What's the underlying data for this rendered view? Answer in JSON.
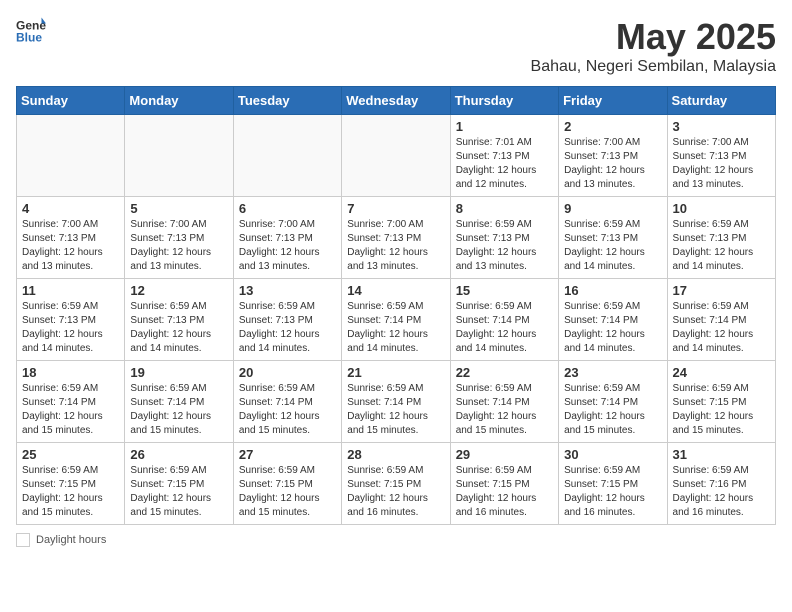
{
  "header": {
    "logo_general": "General",
    "logo_blue": "Blue",
    "title": "May 2025",
    "subtitle": "Bahau, Negeri Sembilan, Malaysia"
  },
  "days_of_week": [
    "Sunday",
    "Monday",
    "Tuesday",
    "Wednesday",
    "Thursday",
    "Friday",
    "Saturday"
  ],
  "weeks": [
    [
      {
        "day": "",
        "info": ""
      },
      {
        "day": "",
        "info": ""
      },
      {
        "day": "",
        "info": ""
      },
      {
        "day": "",
        "info": ""
      },
      {
        "day": "1",
        "info": "Sunrise: 7:01 AM\nSunset: 7:13 PM\nDaylight: 12 hours\nand 12 minutes."
      },
      {
        "day": "2",
        "info": "Sunrise: 7:00 AM\nSunset: 7:13 PM\nDaylight: 12 hours\nand 13 minutes."
      },
      {
        "day": "3",
        "info": "Sunrise: 7:00 AM\nSunset: 7:13 PM\nDaylight: 12 hours\nand 13 minutes."
      }
    ],
    [
      {
        "day": "4",
        "info": "Sunrise: 7:00 AM\nSunset: 7:13 PM\nDaylight: 12 hours\nand 13 minutes."
      },
      {
        "day": "5",
        "info": "Sunrise: 7:00 AM\nSunset: 7:13 PM\nDaylight: 12 hours\nand 13 minutes."
      },
      {
        "day": "6",
        "info": "Sunrise: 7:00 AM\nSunset: 7:13 PM\nDaylight: 12 hours\nand 13 minutes."
      },
      {
        "day": "7",
        "info": "Sunrise: 7:00 AM\nSunset: 7:13 PM\nDaylight: 12 hours\nand 13 minutes."
      },
      {
        "day": "8",
        "info": "Sunrise: 6:59 AM\nSunset: 7:13 PM\nDaylight: 12 hours\nand 13 minutes."
      },
      {
        "day": "9",
        "info": "Sunrise: 6:59 AM\nSunset: 7:13 PM\nDaylight: 12 hours\nand 14 minutes."
      },
      {
        "day": "10",
        "info": "Sunrise: 6:59 AM\nSunset: 7:13 PM\nDaylight: 12 hours\nand 14 minutes."
      }
    ],
    [
      {
        "day": "11",
        "info": "Sunrise: 6:59 AM\nSunset: 7:13 PM\nDaylight: 12 hours\nand 14 minutes."
      },
      {
        "day": "12",
        "info": "Sunrise: 6:59 AM\nSunset: 7:13 PM\nDaylight: 12 hours\nand 14 minutes."
      },
      {
        "day": "13",
        "info": "Sunrise: 6:59 AM\nSunset: 7:13 PM\nDaylight: 12 hours\nand 14 minutes."
      },
      {
        "day": "14",
        "info": "Sunrise: 6:59 AM\nSunset: 7:14 PM\nDaylight: 12 hours\nand 14 minutes."
      },
      {
        "day": "15",
        "info": "Sunrise: 6:59 AM\nSunset: 7:14 PM\nDaylight: 12 hours\nand 14 minutes."
      },
      {
        "day": "16",
        "info": "Sunrise: 6:59 AM\nSunset: 7:14 PM\nDaylight: 12 hours\nand 14 minutes."
      },
      {
        "day": "17",
        "info": "Sunrise: 6:59 AM\nSunset: 7:14 PM\nDaylight: 12 hours\nand 14 minutes."
      }
    ],
    [
      {
        "day": "18",
        "info": "Sunrise: 6:59 AM\nSunset: 7:14 PM\nDaylight: 12 hours\nand 15 minutes."
      },
      {
        "day": "19",
        "info": "Sunrise: 6:59 AM\nSunset: 7:14 PM\nDaylight: 12 hours\nand 15 minutes."
      },
      {
        "day": "20",
        "info": "Sunrise: 6:59 AM\nSunset: 7:14 PM\nDaylight: 12 hours\nand 15 minutes."
      },
      {
        "day": "21",
        "info": "Sunrise: 6:59 AM\nSunset: 7:14 PM\nDaylight: 12 hours\nand 15 minutes."
      },
      {
        "day": "22",
        "info": "Sunrise: 6:59 AM\nSunset: 7:14 PM\nDaylight: 12 hours\nand 15 minutes."
      },
      {
        "day": "23",
        "info": "Sunrise: 6:59 AM\nSunset: 7:14 PM\nDaylight: 12 hours\nand 15 minutes."
      },
      {
        "day": "24",
        "info": "Sunrise: 6:59 AM\nSunset: 7:15 PM\nDaylight: 12 hours\nand 15 minutes."
      }
    ],
    [
      {
        "day": "25",
        "info": "Sunrise: 6:59 AM\nSunset: 7:15 PM\nDaylight: 12 hours\nand 15 minutes."
      },
      {
        "day": "26",
        "info": "Sunrise: 6:59 AM\nSunset: 7:15 PM\nDaylight: 12 hours\nand 15 minutes."
      },
      {
        "day": "27",
        "info": "Sunrise: 6:59 AM\nSunset: 7:15 PM\nDaylight: 12 hours\nand 15 minutes."
      },
      {
        "day": "28",
        "info": "Sunrise: 6:59 AM\nSunset: 7:15 PM\nDaylight: 12 hours\nand 16 minutes."
      },
      {
        "day": "29",
        "info": "Sunrise: 6:59 AM\nSunset: 7:15 PM\nDaylight: 12 hours\nand 16 minutes."
      },
      {
        "day": "30",
        "info": "Sunrise: 6:59 AM\nSunset: 7:15 PM\nDaylight: 12 hours\nand 16 minutes."
      },
      {
        "day": "31",
        "info": "Sunrise: 6:59 AM\nSunset: 7:16 PM\nDaylight: 12 hours\nand 16 minutes."
      }
    ]
  ],
  "footer": {
    "daylight_label": "Daylight hours"
  }
}
